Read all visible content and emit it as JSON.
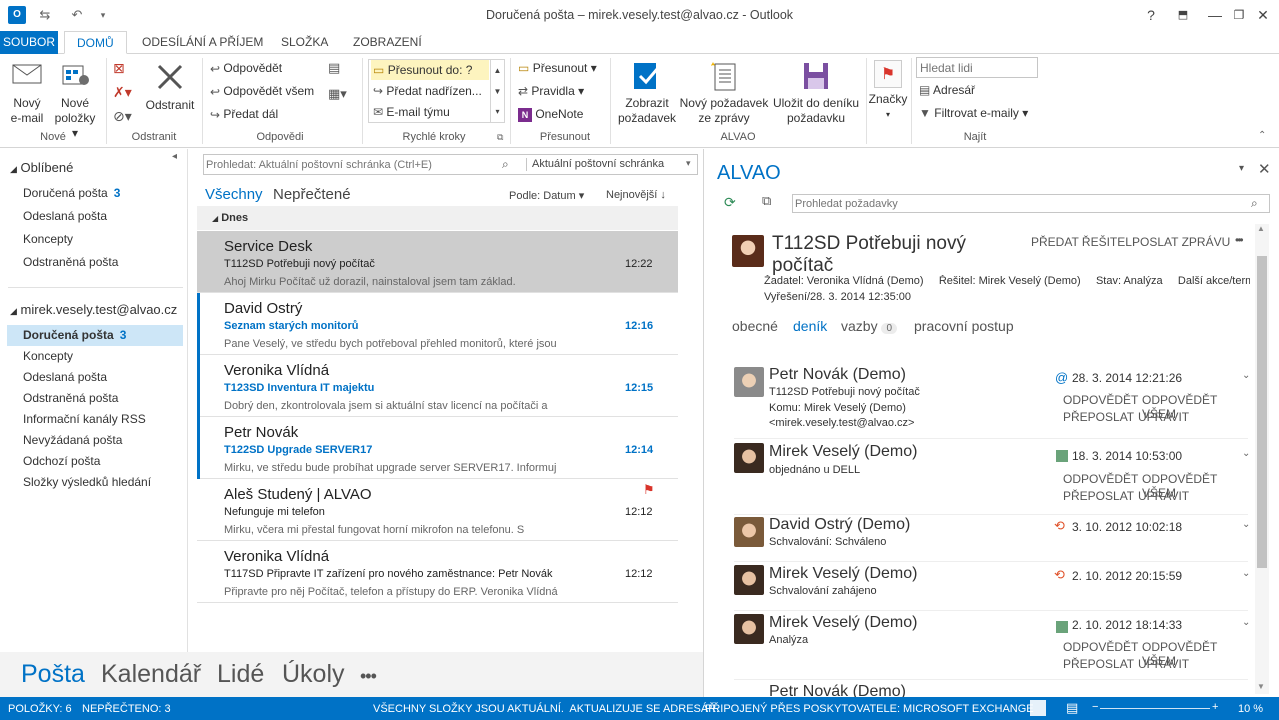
{
  "window": {
    "title": "Doručená pošta – mirek.vesely.test@alvao.cz - Outlook",
    "help": "?",
    "minimize": "—",
    "close": "✕"
  },
  "tabs": [
    "SOUBOR",
    "DOMŮ",
    "ODESÍLÁNÍ A PŘÍJEM",
    "SLOŽKA",
    "ZOBRAZENÍ"
  ],
  "ribbon": {
    "new_email": [
      "Nový",
      "e-mail"
    ],
    "new_items": [
      "Nové",
      "položky ▾"
    ],
    "group_new": "Nové",
    "delete": "Odstranit",
    "group_delete": "Odstranit",
    "reply": "Odpovědět",
    "reply_all": "Odpovědět všem",
    "forward": "Předat dál",
    "group_replies": "Odpovědi",
    "quick1": "Přesunout do: ?",
    "quick2": "Předat nadřízen...",
    "quick3": "E-mail týmu",
    "group_quick": "Rychlé kroky",
    "move": "Přesunout ▾",
    "rules": "Pravidla ▾",
    "onenote": "OneNote",
    "group_move": "Přesunout",
    "show_request": [
      "Zobrazit",
      "požadavek"
    ],
    "new_request": [
      "Nový požadavek",
      "ze zprávy"
    ],
    "save_log": [
      "Uložit do deníku",
      "požadavku"
    ],
    "group_alvao": "ALVAO",
    "tags": "Značky",
    "search_people_placeholder": "Hledat lidi",
    "address_book": "Adresář",
    "filter_email": "Filtrovat e-maily ▾",
    "group_find": "Najít"
  },
  "nav": {
    "favorites": "Oblíbené",
    "fav_items": [
      {
        "label": "Doručená pošta",
        "count": "3"
      },
      {
        "label": "Odeslaná pošta",
        "count": ""
      },
      {
        "label": "Koncepty",
        "count": ""
      },
      {
        "label": "Odstraněná pošta",
        "count": ""
      }
    ],
    "account": "mirek.vesely.test@alvao.cz",
    "acc_items": [
      {
        "label": "Doručená pošta",
        "count": "3"
      },
      {
        "label": "Koncepty",
        "count": ""
      },
      {
        "label": "Odeslaná pošta",
        "count": ""
      },
      {
        "label": "Odstraněná pošta",
        "count": ""
      },
      {
        "label": "Informační kanály RSS",
        "count": ""
      },
      {
        "label": "Nevyžádaná pošta",
        "count": ""
      },
      {
        "label": "Odchozí pošta",
        "count": ""
      },
      {
        "label": "Složky výsledků hledání",
        "count": ""
      }
    ]
  },
  "list": {
    "search_placeholder": "Prohledat: Aktuální poštovní schránka (Ctrl+E)",
    "scope": "Aktuální poštovní schránka",
    "filter_all": "Všechny",
    "filter_unread": "Nepřečtené",
    "sort_by": "Podle: Datum ▾",
    "sort_order": "Nejnovější ↓",
    "group_today": "Dnes",
    "mails": [
      {
        "from": "Service Desk",
        "subject": "T112SD Potřebuji nový počítač",
        "preview": "Ahoj Mirku  Počítač už dorazil, nainstaloval jsem tam základ.",
        "time": "12:22"
      },
      {
        "from": "David Ostrý",
        "subject": "Seznam starých monitorů",
        "preview": "Pane Veselý,  ve středu bych potřeboval přehled monitorů, které jsou",
        "time": "12:16"
      },
      {
        "from": "Veronika Vlídná",
        "subject": "T123SD Inventura IT majektu",
        "preview": "Dobrý den,  zkontrolovala jsem si aktuální stav licencí na počítači a",
        "time": "12:15"
      },
      {
        "from": "Petr Novák",
        "subject": "T122SD Upgrade SERVER17",
        "preview": "Mirku,  ve středu bude probíhat upgrade server SERVER17.  Informuj",
        "time": "12:14"
      },
      {
        "from": "Aleš Studený | ALVAO",
        "subject": "Nefunguje mi telefon",
        "preview": "Mirku,  včera mi přestal fungovat horní mikrofon na telefonu.  S",
        "time": "12:12"
      },
      {
        "from": "Veronika Vlídná",
        "subject": "T117SD Připravte IT zařízení pro nového zaměstnance: Petr Novák",
        "preview": "Připravte pro něj Počítač, telefon a přístupy do ERP.  Veronika Vlídná",
        "time": "12:12"
      }
    ]
  },
  "pane": {
    "title": "ALVAO",
    "search_placeholder": "Prohledat požadavky",
    "request_title": [
      "T112SD Potřebuji nový",
      "počítač"
    ],
    "action_solver": "PŘEDAT ŘEŠITELI",
    "action_message": "POSLAT ZPRÁVU",
    "more": "•••",
    "meta_line1": "Žadatel: Veronika Vlídná (Demo)     Řešitel: Mirek Veselý (Demo)     Stav: Analýza     Další akce/termín:",
    "meta_line2": "Vyřešení/28. 3. 2014 12:35:00",
    "tabs": [
      "obecné",
      "deník",
      "vazby",
      "pracovní postup"
    ],
    "links_count": "0",
    "entries": [
      {
        "name": "Petr Novák (Demo)",
        "date": "28. 3. 2014 12:21:26",
        "lines": [
          "T112SD Potřebuji nový počítač",
          "Komu: Mirek Veselý (Demo)",
          "<mirek.vesely.test@alvao.cz>"
        ],
        "actions": true
      },
      {
        "name": "Mirek Veselý (Demo)",
        "date": "18. 3. 2014 10:53:00",
        "lines": [
          "objednáno u DELL"
        ],
        "actions": true
      },
      {
        "name": "David Ostrý (Demo)",
        "date": "3. 10. 2012 10:02:18",
        "lines": [
          "Schvalování: Schváleno"
        ],
        "actions": false
      },
      {
        "name": "Mirek Veselý (Demo)",
        "date": "2. 10. 2012 20:15:59",
        "lines": [
          "Schvalování zahájeno"
        ],
        "actions": false
      },
      {
        "name": "Mirek Veselý (Demo)",
        "date": "2. 10. 2012 18:14:33",
        "lines": [
          "Analýza"
        ],
        "actions": true
      }
    ],
    "act_reply": "ODPOVĚDĚT",
    "act_reply_all": "ODPOVĚDĚT VŠEM",
    "act_forward": "PŘEPOSLAT",
    "act_edit": "UPRAVIT",
    "partial_entry": "Petr Novák (Demo)"
  },
  "bottomnav": [
    "Pošta",
    "Kalendář",
    "Lidé",
    "Úkoly",
    "•••"
  ],
  "status": {
    "items": "POLOŽKY: 6",
    "unread": "NEPŘEČTENO: 3",
    "folders": "VŠECHNY SLOŽKY JSOU AKTUÁLNÍ.  AKTUALIZUJE SE ADRESÁŘ.",
    "connected": "PŘIPOJENÝ PŘES POSKYTOVATELE: MICROSOFT EXCHANGE",
    "zoom": "10 %"
  },
  "colors": {
    "accent": "#0072c6",
    "selected": "#cde6f7",
    "status": "#0072c6"
  }
}
